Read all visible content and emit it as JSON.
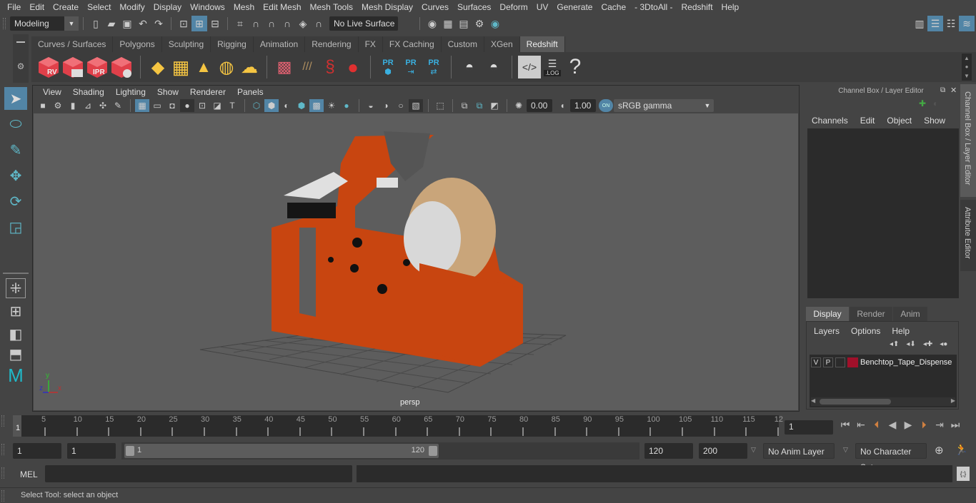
{
  "menubar": [
    "File",
    "Edit",
    "Create",
    "Select",
    "Modify",
    "Display",
    "Windows",
    "Mesh",
    "Edit Mesh",
    "Mesh Tools",
    "Mesh Display",
    "Curves",
    "Surfaces",
    "Deform",
    "UV",
    "Generate",
    "Cache",
    "- 3DtoAll -",
    "Redshift",
    "Help"
  ],
  "statusline": {
    "workspace": "Modeling",
    "live_surface": "No Live Surface"
  },
  "shelf": {
    "tabs": [
      "Curves / Surfaces",
      "Polygons",
      "Sculpting",
      "Rigging",
      "Animation",
      "Rendering",
      "FX",
      "FX Caching",
      "Custom",
      "XGen",
      "Redshift"
    ],
    "active_tab": "Redshift",
    "redshift_labels": [
      "RV",
      "",
      "IPR",
      ""
    ],
    "pr_labels": [
      "PR",
      "PR",
      "PR"
    ],
    "log_label": ".LOG",
    "help_glyph": "?"
  },
  "viewport": {
    "menu": [
      "View",
      "Shading",
      "Lighting",
      "Show",
      "Renderer",
      "Panels"
    ],
    "exposure": "0.00",
    "gamma": "1.00",
    "color_mgmt_toggle": "ON",
    "color_space": "sRGB gamma",
    "camera_label": "persp",
    "axis_labels": {
      "x": "x",
      "y": "y",
      "z": "z"
    },
    "model_colors": {
      "body": "#c84510",
      "tape": "#c9a57a",
      "white": "#e0e0e0",
      "dark": "#151515"
    }
  },
  "channel_box": {
    "title": "Channel Box / Layer Editor",
    "menu": [
      "Channels",
      "Edit",
      "Object",
      "Show"
    ],
    "layer_tabs": [
      "Display",
      "Render",
      "Anim"
    ],
    "active_layer_tab": "Display",
    "layer_menu": [
      "Layers",
      "Options",
      "Help"
    ],
    "layers": [
      {
        "v": "V",
        "p": "P",
        "color": "#a0102a",
        "name": "Benchtop_Tape_Dispense"
      }
    ]
  },
  "side_tabs": [
    "Channel Box / Layer Editor",
    "Attribute Editor"
  ],
  "timeline": {
    "ticks": [
      "5",
      "10",
      "15",
      "20",
      "25",
      "30",
      "35",
      "40",
      "45",
      "50",
      "55",
      "60",
      "65",
      "70",
      "75",
      "80",
      "85",
      "90",
      "95",
      "100",
      "105",
      "110",
      "115",
      "12"
    ],
    "current_frame_marker": "1",
    "current_frame": "1"
  },
  "range": {
    "start": "1",
    "current": "1",
    "slider_start": "1",
    "slider_end": "120",
    "end": "120",
    "anim_end": "200",
    "anim_layer": "No Anim Layer",
    "character_set": "No Character Set"
  },
  "mel": {
    "label": "MEL",
    "input": "",
    "output": ""
  },
  "help_line": "Select Tool: select an object"
}
